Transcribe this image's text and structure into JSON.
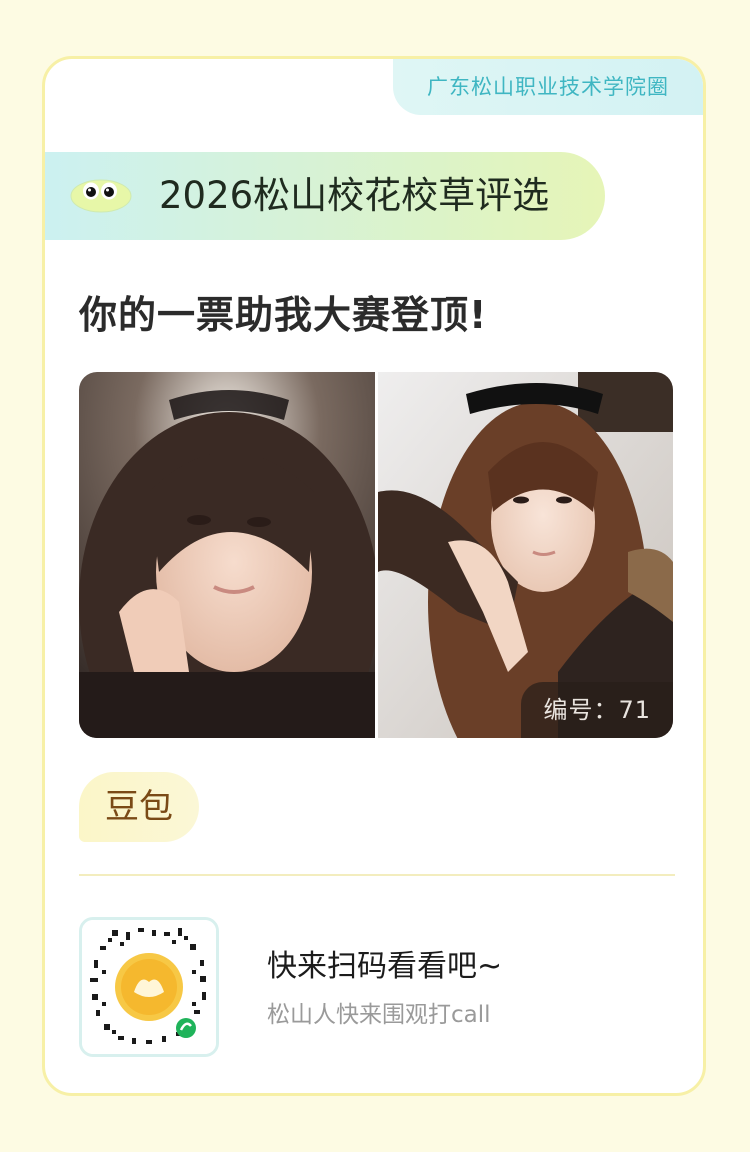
{
  "school_tag": "广东松山职业技术学院圈",
  "title": "2026松山校花校草评选",
  "slogan": "你的一票助我大赛登顶!",
  "number_badge": "编号：71",
  "contestant_name": "豆包",
  "cta": {
    "title": "快来扫码看看吧~",
    "subtitle": "松山人快来围观打call"
  },
  "icons": {
    "title_icon": "cartoon-eyes-icon",
    "qr_code": "mini-program-qr-code-icon"
  },
  "colors": {
    "page_background": "#fdfbe3",
    "card_border": "#f7f0a6",
    "school_tag_text": "#3fb6c2",
    "name_text": "#7a4a16",
    "qr_badge_green": "#1fb35a"
  }
}
